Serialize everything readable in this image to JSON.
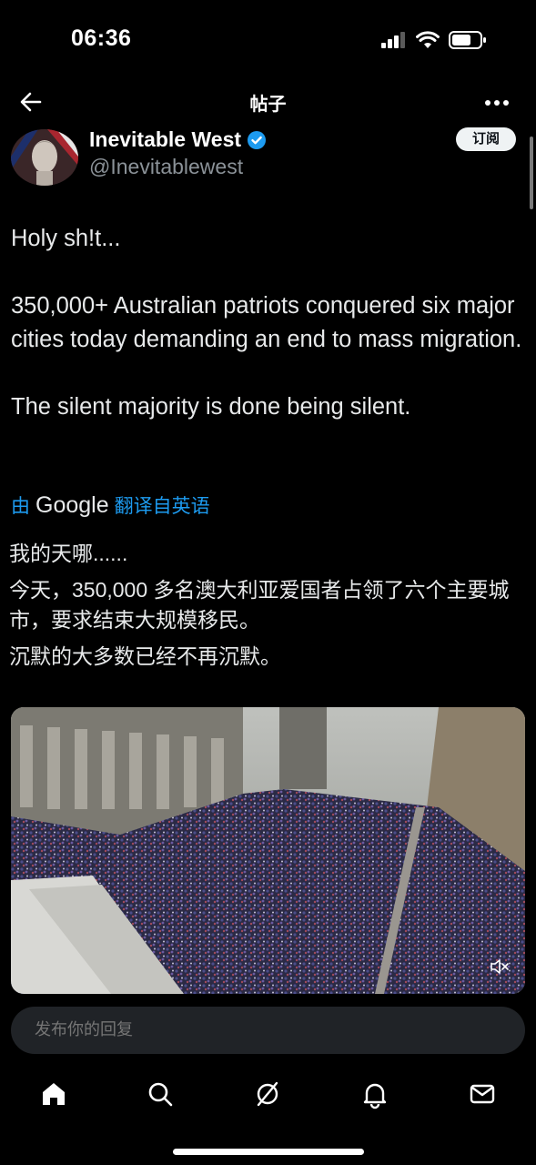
{
  "status": {
    "time": "06:36"
  },
  "header": {
    "title": "帖子"
  },
  "author": {
    "name": "Inevitable West",
    "handle": "@Inevitablewest",
    "subscribe_label": "订阅"
  },
  "tweet": {
    "paragraphs": [
      "Holy sh!t...",
      "350,000+ Australian patriots conquered six major cities today demanding an end to mass migration.",
      "The silent majority is done being silent."
    ]
  },
  "translation": {
    "prefix": "由",
    "brand": "Google",
    "suffix": "翻译自英语",
    "paragraphs": [
      "我的天哪......",
      "今天，350,000 多名澳大利亚爱国者占领了六个主要城市，要求结束大规模移民。",
      "沉默的大多数已经不再沉默。"
    ]
  },
  "reply": {
    "placeholder": "发布你的回复"
  },
  "tabs": [
    "home-icon",
    "search-icon",
    "grok-icon",
    "notifications-icon",
    "messages-icon"
  ],
  "colors": {
    "accent": "#1d9bf0",
    "background": "#000000",
    "text": "#e7e9ea",
    "muted": "#8b9298"
  }
}
